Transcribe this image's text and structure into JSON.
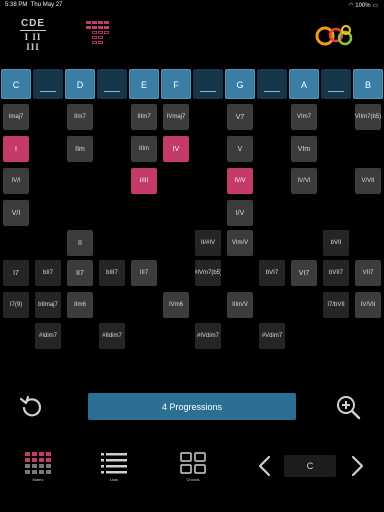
{
  "status_bar": {
    "time": "5:38 PM",
    "date": "Thu May 27",
    "battery": "100%"
  },
  "logo": {
    "top": "CDE",
    "bottom": "I II III"
  },
  "keys": [
    {
      "label": "C",
      "type": "white"
    },
    {
      "label": "",
      "type": "black"
    },
    {
      "label": "D",
      "type": "white"
    },
    {
      "label": "",
      "type": "black"
    },
    {
      "label": "E",
      "type": "white"
    },
    {
      "label": "F",
      "type": "white"
    },
    {
      "label": "",
      "type": "black"
    },
    {
      "label": "G",
      "type": "white"
    },
    {
      "label": "",
      "type": "black"
    },
    {
      "label": "A",
      "type": "white"
    },
    {
      "label": "",
      "type": "black"
    },
    {
      "label": "B",
      "type": "white"
    }
  ],
  "chords": [
    {
      "label": "Imaj7",
      "col": 0,
      "row": 0
    },
    {
      "label": "IIm7",
      "col": 2,
      "row": 0
    },
    {
      "label": "IIIm7",
      "col": 4,
      "row": 0
    },
    {
      "label": "IVmaj7",
      "col": 5,
      "row": 0
    },
    {
      "label": "V7",
      "col": 7,
      "row": 0
    },
    {
      "label": "VIm7",
      "col": 9,
      "row": 0
    },
    {
      "label": "VIIm7(b5)",
      "col": 11,
      "row": 0
    },
    {
      "label": "I",
      "col": 0,
      "row": 1,
      "style": "pink"
    },
    {
      "label": "IIm",
      "col": 2,
      "row": 1
    },
    {
      "label": "IIIm",
      "col": 4,
      "row": 1
    },
    {
      "label": "IV",
      "col": 5,
      "row": 1,
      "style": "pink"
    },
    {
      "label": "V",
      "col": 7,
      "row": 1
    },
    {
      "label": "VIm",
      "col": 9,
      "row": 1
    },
    {
      "label": "IV/I",
      "col": 0,
      "row": 2
    },
    {
      "label": "I/III",
      "col": 4,
      "row": 2,
      "style": "pink"
    },
    {
      "label": "IV/V",
      "col": 7,
      "row": 2,
      "style": "pink"
    },
    {
      "label": "IV/VI",
      "col": 9,
      "row": 2
    },
    {
      "label": "V/VII",
      "col": 11,
      "row": 2
    },
    {
      "label": "V/I",
      "col": 0,
      "row": 3
    },
    {
      "label": "I/V",
      "col": 7,
      "row": 3
    },
    {
      "label": "II",
      "col": 2,
      "row": 4
    },
    {
      "label": "II/#IV",
      "col": 6,
      "row": 4,
      "style": "dark"
    },
    {
      "label": "VIm/V",
      "col": 7,
      "row": 4
    },
    {
      "label": "bVII",
      "col": 10,
      "row": 4,
      "style": "dark"
    },
    {
      "label": "I7",
      "col": 0,
      "row": 5,
      "style": "dark"
    },
    {
      "label": "bII7",
      "col": 1,
      "row": 5,
      "style": "dark"
    },
    {
      "label": "II7",
      "col": 2,
      "row": 5
    },
    {
      "label": "bIII7",
      "col": 3,
      "row": 5,
      "style": "dark"
    },
    {
      "label": "III7",
      "col": 4,
      "row": 5
    },
    {
      "label": "#IVm7(b5)",
      "col": 6,
      "row": 5,
      "style": "dark"
    },
    {
      "label": "bVI7",
      "col": 8,
      "row": 5,
      "style": "dark"
    },
    {
      "label": "VI7",
      "col": 9,
      "row": 5
    },
    {
      "label": "bVII7",
      "col": 10,
      "row": 5,
      "style": "dark"
    },
    {
      "label": "VII7",
      "col": 11,
      "row": 5
    },
    {
      "label": "I7(9)",
      "col": 0,
      "row": 6,
      "style": "dark"
    },
    {
      "label": "bIImaj7",
      "col": 1,
      "row": 6,
      "style": "dark"
    },
    {
      "label": "IIm6",
      "col": 2,
      "row": 6
    },
    {
      "label": "IVm6",
      "col": 5,
      "row": 6
    },
    {
      "label": "IIIm/V",
      "col": 7,
      "row": 6
    },
    {
      "label": "I7/bVII",
      "col": 10,
      "row": 6,
      "style": "dark"
    },
    {
      "label": "IV/VII",
      "col": 11,
      "row": 6
    },
    {
      "label": "#Idim7",
      "col": 1,
      "row": 7,
      "style": "dark"
    },
    {
      "label": "#IIdim7",
      "col": 3,
      "row": 7,
      "style": "dark"
    },
    {
      "label": "#IVdim7",
      "col": 6,
      "row": 7,
      "style": "dark"
    },
    {
      "label": "#Vdim7",
      "col": 8,
      "row": 7,
      "style": "dark"
    }
  ],
  "controls": {
    "progressions_label": "4 Progressions"
  },
  "tabs": [
    {
      "label": "Matrix"
    },
    {
      "label": "Lists"
    },
    {
      "label": "Chords"
    }
  ],
  "key_selector": {
    "value": "C"
  },
  "colors": {
    "accent": "#2b6f93",
    "highlight": "#c43a68",
    "key_white": "#3a7ea4"
  }
}
